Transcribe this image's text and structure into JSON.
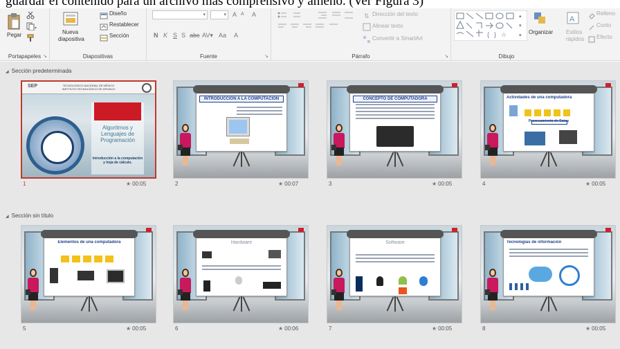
{
  "caption": "guardar el contenido para un archivo más comprensivo y ameno. (Ver Figura 3)",
  "ribbon": {
    "portapapeles": {
      "label": "Portapapeles",
      "paste": "Pegar"
    },
    "diapositivas": {
      "label": "Diapositivas",
      "new_slide": "Nueva",
      "new_slide2": "diapositiva",
      "layout": "Diseño",
      "reset": "Restablecer",
      "section": "Sección"
    },
    "fuente": {
      "label": "Fuente",
      "bold": "N",
      "italic": "K",
      "underline": "S",
      "strike": "S",
      "spacing": "abc",
      "case": "Aa",
      "grow": "A",
      "shrink": "A",
      "clear": "A",
      "color": "A"
    },
    "parrafo": {
      "label": "Párrafo",
      "text_direction": "Dirección del texto",
      "align_text": "Alinear texto",
      "smartart": "Convertir a SmartArt"
    },
    "dibujo": {
      "label": "Dibujo",
      "arrange": "Organizar",
      "styles": "Estilos",
      "styles2": "rápidos",
      "fill": "Relleno",
      "outline": "Conto",
      "effects": "Efecto"
    }
  },
  "sections": [
    {
      "title": "Sección predeterminada"
    },
    {
      "title": "Sección sin título"
    }
  ],
  "slides": [
    {
      "num": "1",
      "dur": "00:05",
      "inst": "TECNOLÓGICO NACIONAL DE MÉXICO",
      "inst2": "INSTITUTO TECNOLÓGICO DE APIZACO",
      "sep": "SEP",
      "title": "Algoritmos y Lenguajes de Programación",
      "subtitle": "Introducción a la computación y hoja de cálculo."
    },
    {
      "num": "2",
      "dur": "00:07",
      "title": "INTRODUCCIÓN A LA COMPUTACIÓN"
    },
    {
      "num": "3",
      "dur": "00:05",
      "title": "CONCEPTO DE COMPUTADORA"
    },
    {
      "num": "4",
      "dur": "00:05",
      "title": "Actividades de una computadora",
      "subtitle": "Procesamiento de Datos"
    },
    {
      "num": "5",
      "dur": "00:05",
      "title": "Elementos de una computadora"
    },
    {
      "num": "6",
      "dur": "00:06",
      "title": "Hardware"
    },
    {
      "num": "7",
      "dur": "00:05",
      "title": "Software"
    },
    {
      "num": "8",
      "dur": "00:05",
      "title": "Tecnologías de información"
    }
  ],
  "colors": {
    "selection": "#c0392b",
    "board_title": "#1d3f8a",
    "person": "#c9185c"
  }
}
